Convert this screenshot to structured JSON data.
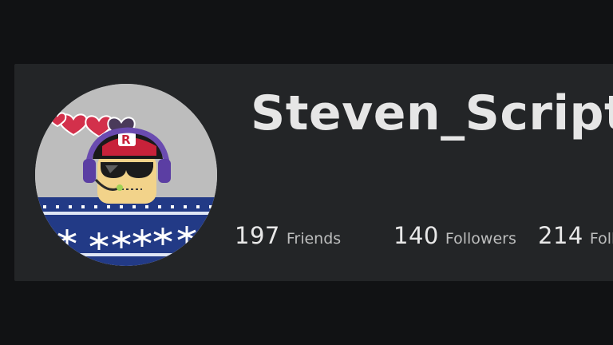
{
  "profile": {
    "username": "Steven_Scripts",
    "stats": {
      "friends": {
        "count": "197",
        "label": "Friends"
      },
      "followers": {
        "count": "140",
        "label": "Followers"
      },
      "following": {
        "count": "214",
        "label": "Following"
      }
    }
  },
  "colors": {
    "page_background": "#111214",
    "card_background": "#232527",
    "username_text": "#e6e6e6",
    "stat_label_text": "#bdbebe"
  }
}
